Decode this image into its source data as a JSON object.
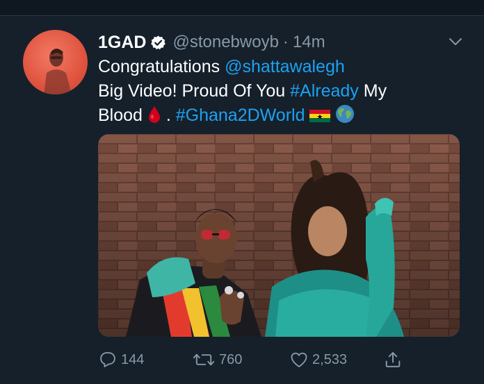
{
  "tweet": {
    "display_name": "1GAD",
    "handle": "@stonebwoyb",
    "separator": "·",
    "time": "14m",
    "text": {
      "line1_prefix": "Congratulations ",
      "mention": "@shattawalegh",
      "line2_prefix": "Big Video! Proud Of You ",
      "hashtag1": "#Already",
      "line2_suffix": " My",
      "line3_prefix": "Blood ",
      "line3_mid": " . ",
      "hashtag2": "#Ghana2DWorld"
    },
    "emojis": [
      "blood-drop-emoji",
      "ghana-flag-emoji",
      "globe-emoji"
    ]
  },
  "actions": {
    "reply_count": "144",
    "retweet_count": "760",
    "like_count": "2,533"
  },
  "colors": {
    "background": "#15202b",
    "link": "#1da1f2",
    "secondary": "#8899a6",
    "avatar_bg": "#e0543f"
  }
}
